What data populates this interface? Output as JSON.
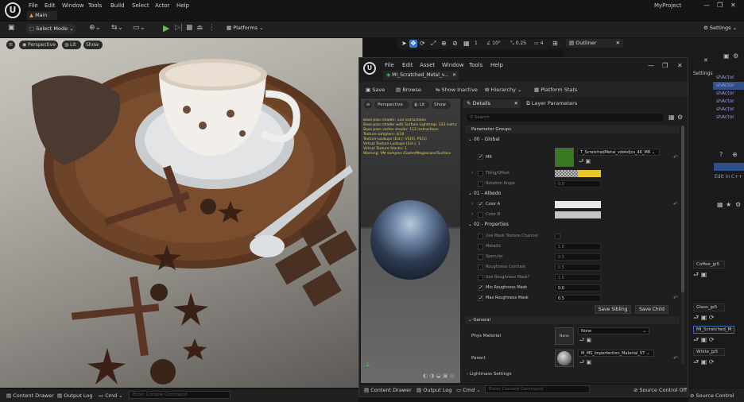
{
  "main_menu": [
    "File",
    "Edit",
    "Window",
    "Tools",
    "Build",
    "Select",
    "Actor",
    "Help"
  ],
  "project_name": "MyProject",
  "level_tab": "Main",
  "toolbar": {
    "select_mode": "Select Mode",
    "platforms": "Platforms",
    "settings": "Settings"
  },
  "viewport": {
    "perspective": "Perspective",
    "lit": "Lit",
    "show": "Show",
    "snap_angle": "10°",
    "snap_scale": "0.25",
    "camera_speed": "4"
  },
  "outliner": {
    "title": "Outliner",
    "items": [
      "shActor",
      "shActor",
      "shActor",
      "shActor",
      "shActor",
      "shActor"
    ],
    "edit_in_cpp": "Edit in C++"
  },
  "right_panel_assets": [
    "Coffee_jp5",
    "Glass_jp5",
    "MI_Scratched_M",
    "White_jp5"
  ],
  "material_editor": {
    "menu": [
      "File",
      "Edit",
      "Asset",
      "Window",
      "Tools",
      "Help"
    ],
    "tab_title": "MI_Scratched_Metal_v...",
    "toolbar": [
      "Save",
      "Browse",
      "Show Inactive",
      "Hierarchy",
      "Platform Stats"
    ],
    "preview": {
      "perspective": "Perspective",
      "lit": "Lit",
      "show": "Show"
    },
    "stats_lines": [
      "Base pass shader: 333 instructions",
      "Base pass shader with Surface Lightmap: 333 instru",
      "Base pass vertex shader: 112 instructions",
      "Texture samplers: 4/16",
      "Texture Lookups (Est.): VS(0), PS(1)",
      "Virtual Texture Lookups (Est.): 1",
      "Virtual Texture Stacks: 1",
      "Warning: VM samples /Game/Megascans/Surface"
    ],
    "details_tab": "Details",
    "layer_params_tab": "Layer Parameters",
    "search_placeholder": "Search",
    "param_groups_header": "Parameter Groups",
    "group_global": "00 - Global",
    "mr_label": "MR",
    "mr_texture": "T_ScratchedMetal_vdekdjcs_4K_MR",
    "tiling_offset": "Tiling/Offset",
    "rotation_angle": "Rotation Angle",
    "rotation_value": "0.0",
    "group_albedo": "01 - Albedo",
    "color_a": "Color A",
    "color_b": "Color B",
    "group_properties": "02 - Properties",
    "props": [
      {
        "label": "Use Mask Texture Channel",
        "value": "",
        "on": false
      },
      {
        "label": "Metallic",
        "value": "1.0",
        "on": false
      },
      {
        "label": "Specular",
        "value": "0.5",
        "on": false
      },
      {
        "label": "Roughness Contrast",
        "value": "0.5",
        "on": false
      },
      {
        "label": "Use Roughness Mask?",
        "value": "1.0",
        "on": false
      },
      {
        "label": "Min Roughness Mask",
        "value": "0.0",
        "on": true
      },
      {
        "label": "Max Roughness Mask",
        "value": "0.5",
        "on": true
      }
    ],
    "save_sibling": "Save Sibling",
    "save_child": "Save Child",
    "general_header": "General",
    "phys_material_label": "Phys Material",
    "phys_material_value": "None",
    "phys_thumb": "None",
    "parent_label": "Parent",
    "parent_value": "M_MS_Imperfection_Material_VT",
    "lightmass_settings": "Lightmass Settings",
    "content_drawer": "Content Drawer",
    "output_log": "Output Log",
    "cmd": "Cmd",
    "console_placeholder": "Enter Console Command",
    "source_control": "Source Control Off"
  },
  "bottom_bar": {
    "content_drawer": "Content Drawer",
    "output_log": "Output Log",
    "cmd": "Cmd",
    "console_placeholder": "Enter Console Command",
    "source_control": "Source Control"
  },
  "colors": {
    "accent_blue": "#2f7ad8",
    "mr_green": "#3a7a20",
    "yellow": "#e6c62a"
  }
}
